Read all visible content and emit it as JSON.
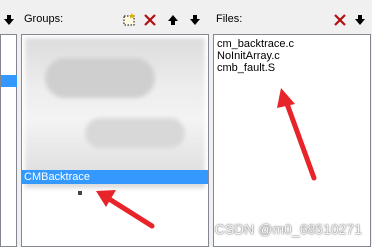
{
  "groups": {
    "label": "Groups:",
    "selected_item": "CMBacktrace"
  },
  "files": {
    "label": "Files:",
    "items": [
      "cm_backtrace.c",
      "NoInitArray.c",
      "cmb_fault.S"
    ]
  },
  "annotation_color": "#e8232a",
  "selection_color": "#3399ff",
  "watermark": "CSDN @m0_68510271"
}
